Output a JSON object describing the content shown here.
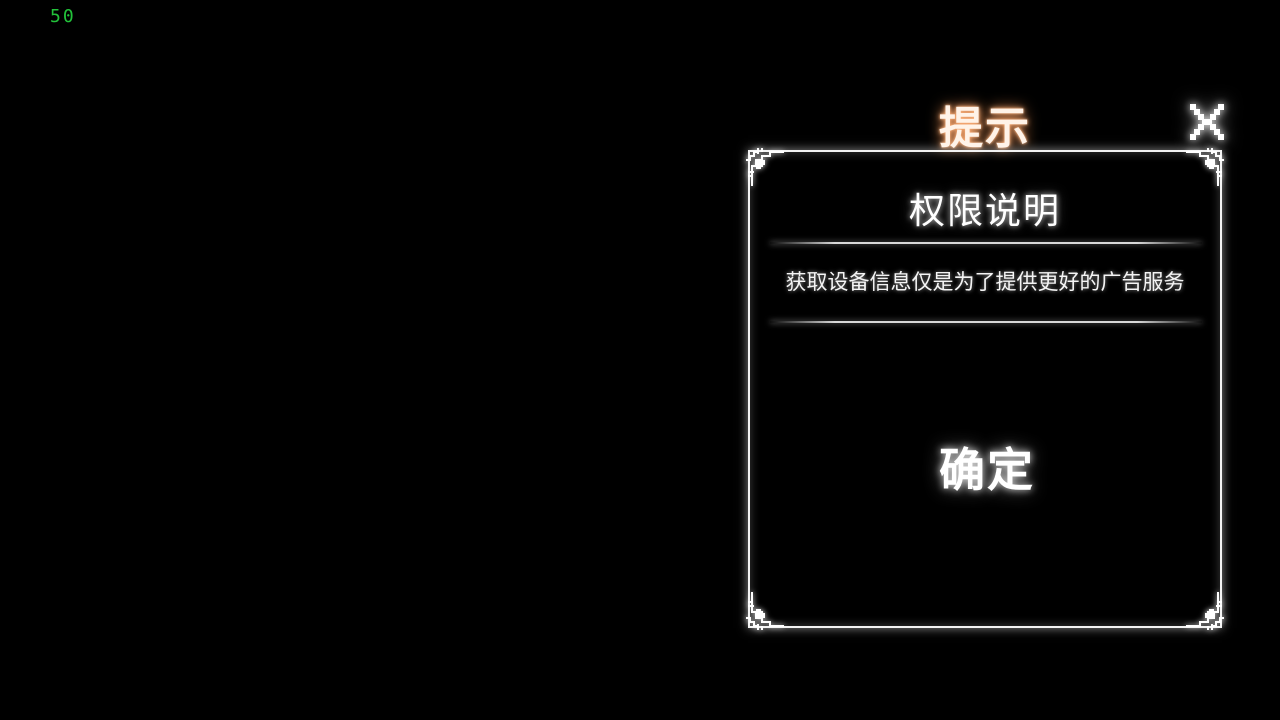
{
  "hud": {
    "fps": "50"
  },
  "dialog": {
    "title": "提示",
    "heading": "权限说明",
    "message": "获取设备信息仅是为了提供更好的广告服务",
    "confirm_label": "确定",
    "close_icon": "close-x-icon"
  },
  "colors": {
    "background": "#000000",
    "fps_text": "#22c23a",
    "title_glow": "#ff9a5a",
    "border": "#f2f2f2",
    "text": "#ffffff"
  }
}
